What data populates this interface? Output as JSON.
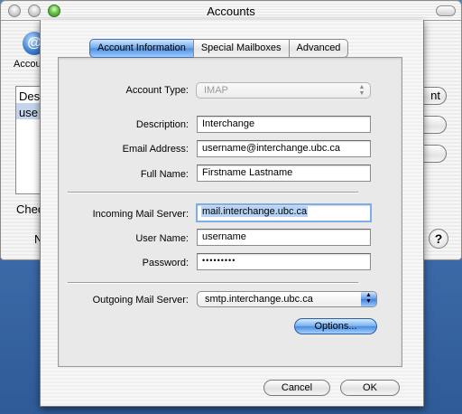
{
  "window": {
    "title": "Accounts"
  },
  "background_window": {
    "toolbar_label": "Accou",
    "list_items": [
      "Des",
      "use"
    ],
    "side_buttons": [
      "nt",
      "",
      ""
    ],
    "check_label": "Chec",
    "n_label": "N",
    "help_label": "?"
  },
  "tabs": [
    {
      "label": "Account Information",
      "active": true
    },
    {
      "label": "Special Mailboxes",
      "active": false
    },
    {
      "label": "Advanced",
      "active": false
    }
  ],
  "form": {
    "account_type": {
      "label": "Account Type:",
      "value": "IMAP",
      "enabled": false
    },
    "description": {
      "label": "Description:",
      "value": "Interchange"
    },
    "email": {
      "label": "Email Address:",
      "value": "username@interchange.ubc.ca"
    },
    "full_name": {
      "label": "Full Name:",
      "value": "Firstname Lastname"
    },
    "incoming_server": {
      "label": "Incoming Mail Server:",
      "value": "mail.interchange.ubc.ca"
    },
    "user_name": {
      "label": "User Name:",
      "value": "username"
    },
    "password": {
      "label": "Password:",
      "value": "•••••••••"
    },
    "outgoing_server": {
      "label": "Outgoing Mail Server:",
      "value": "smtp.interchange.ubc.ca"
    }
  },
  "buttons": {
    "options": "Options...",
    "cancel": "Cancel",
    "ok": "OK"
  },
  "icons": {
    "popup_arrows_icon": "▲▼",
    "accounts_icon": "@"
  },
  "colors": {
    "accent_blue": "#4d8fe0",
    "desktop_blue": "#3c6aa8"
  }
}
